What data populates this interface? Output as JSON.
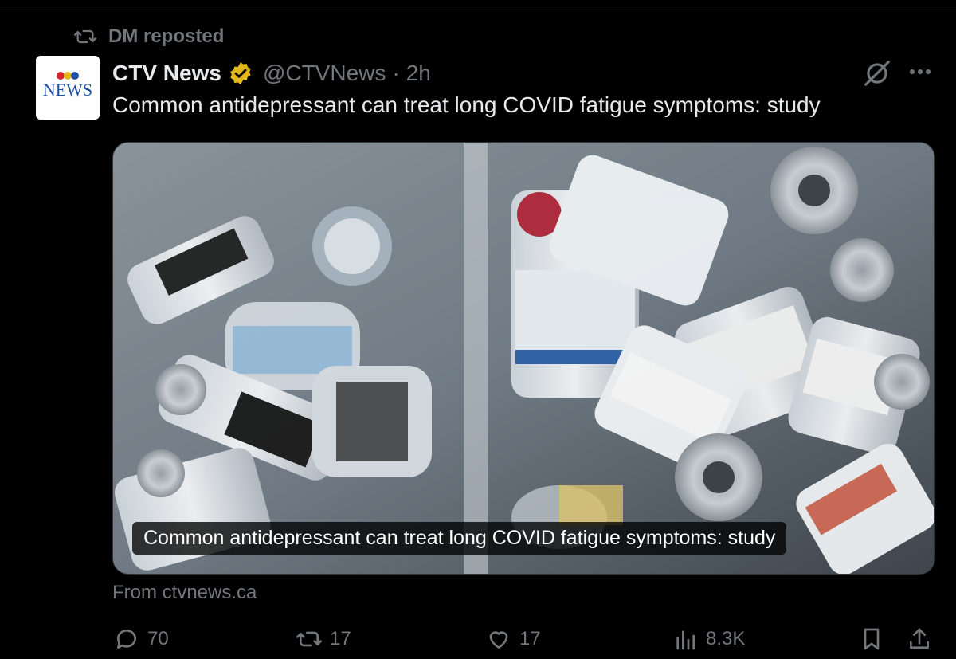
{
  "repost": {
    "label": "DM reposted",
    "icon": "repost-icon"
  },
  "author": {
    "name": "CTV News",
    "handle": "@CTVNews",
    "separator": "·",
    "time": "2h",
    "verified_badge": "gold-verified-badge-icon",
    "avatar": {
      "logo_text": "NEWS",
      "logo_top": "CTV"
    }
  },
  "tweet": {
    "text": "Common antidepressant can treat long COVID fatigue symptoms: study"
  },
  "media": {
    "caption": "Common antidepressant can treat long COVID fatigue symptoms: study",
    "description_icon": "vaccine-vials-photo"
  },
  "link": {
    "source": "From ctvnews.ca"
  },
  "actions": {
    "replies": "70",
    "reposts": "17",
    "likes": "17",
    "views": "8.3K"
  },
  "colors": {
    "background": "#000000",
    "text_primary": "#e7e9ea",
    "text_secondary": "#71767b",
    "verified_gold": "#e2b719",
    "ctv_red": "#d9262e",
    "ctv_blue": "#1f4ea3"
  }
}
